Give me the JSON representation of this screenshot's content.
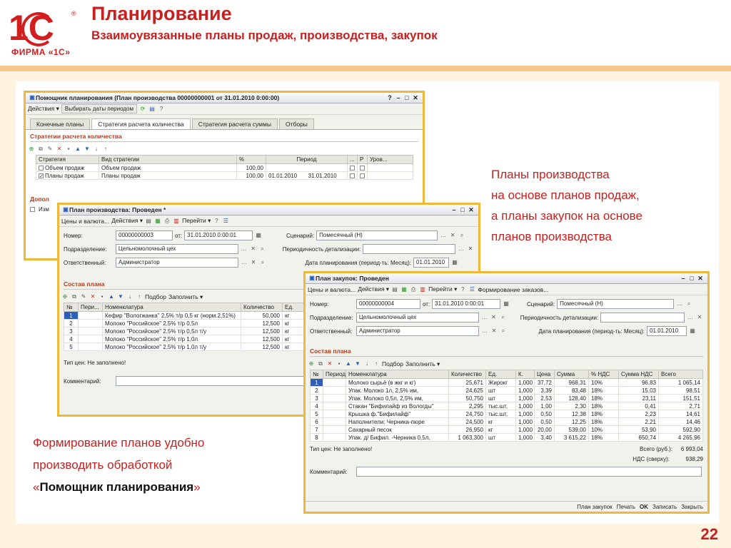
{
  "header": {
    "title": "Планирование",
    "subtitle": "Взаимоувязанные планы продаж, производства, закупок",
    "logo_caption": "ФИРМА «1С»"
  },
  "note_right": [
    "Планы производства",
    "на основе планов продаж,",
    "а планы закупок на основе",
    "планов производства"
  ],
  "note_left": {
    "l1": "Формирование планов  удобно",
    "l2": "производить обработкой",
    "q_open": "«",
    "strong": "Помощник планирования",
    "q_close": "»"
  },
  "page_number": "22",
  "colors": {
    "accent": "#c8201e",
    "frame": "#f0b83a",
    "selection": "#2e5fb8"
  },
  "w1": {
    "title": "Помощник планирования (План производства 00000000001 от 31.01.2010 0:00:00)",
    "actions": "Действия ▾",
    "select_dates": "Выбирать даты периодом",
    "tabs": [
      "Конечные планы",
      "Стратегия расчета количества",
      "Стратегия расчета суммы",
      "Отборы"
    ],
    "section": "Стратегии расчета количества",
    "cols": [
      "Стратегия",
      "Вид стратегии",
      "%",
      "Период",
      "...",
      "Р",
      "Уров..."
    ],
    "rows": [
      {
        "name": "Объем продаж",
        "kind": "Объем продаж",
        "pct": "100,00",
        "from": "",
        "to": "",
        "checked": false
      },
      {
        "name": "Планы продаж",
        "kind": "Планы продаж",
        "pct": "100,00",
        "from": "01.01.2010",
        "to": "31.01.2010",
        "checked": true
      }
    ],
    "extra_section": "Допол",
    "extra_check": "Изм"
  },
  "w2": {
    "title": "План производства: Проведен *",
    "toolbar": [
      "Цены и валюта...",
      "Действия ▾",
      "Перейти ▾"
    ],
    "number_label": "Номер:",
    "number": "00000000003",
    "date_label": "от:",
    "date": "31.01.2010  0:00:01",
    "scenario_label": "Сценарий:",
    "scenario": "Помесячный (Н)",
    "division_label": "Подразделение:",
    "division": "Цельномолочный цех",
    "detail_label": "Периодичность детализации:",
    "detail": "",
    "resp_label": "Ответственный:",
    "resp": "Администратор",
    "plan_date_label": "Дата планирования (период-ть: Месяц):",
    "plan_date": "01.01.2010",
    "section": "Состав плана",
    "pick": "Подбор",
    "fill": "Заполнить ▾",
    "cols": [
      "№",
      "Пери...",
      "Номенклатура",
      "Количество",
      "Ед."
    ],
    "rows": [
      [
        "1",
        "",
        "Кефир \"Вологжанка\" 2,5% т/р 0,5 кг (норм.2,51%)",
        "50,000",
        "кг"
      ],
      [
        "2",
        "",
        "Молоко \"Российское\" 2,5% т/р 0,5л",
        "12,500",
        "кг"
      ],
      [
        "3",
        "",
        "Молоко \"Российское\" 2,5% т/р 0,5л т/у",
        "12,500",
        "кг"
      ],
      [
        "4",
        "",
        "Молоко \"Российское\" 2,5% т/р 1,0л",
        "12,500",
        "кг"
      ],
      [
        "5",
        "",
        "Молоко \"Российское\" 2,5% т/р 1,0л т/у",
        "12,500",
        "кг"
      ]
    ],
    "price_type": "Тип цен: Не заполнено!",
    "comment_label": "Комментарий:"
  },
  "w3": {
    "title": "План закупок: Проведен",
    "toolbar": [
      "Цены и валюта...",
      "Действия ▾",
      "Перейти ▾",
      "Формирование заказов..."
    ],
    "number_label": "Номер:",
    "number": "00000000004",
    "date_label": "от:",
    "date": "31.01.2010  0:00:01",
    "scenario_label": "Сценарий:",
    "scenario": "Помесячный (Н)",
    "division_label": "Подразделение:",
    "division": "Цельномолочный цех",
    "detail_label": "Периодичность детализации:",
    "detail": "",
    "resp_label": "Ответственный:",
    "resp": "Администратор",
    "plan_date_label": "Дата планирования (период-ть: Месяц):",
    "plan_date": "01.01.2010",
    "section": "Состав плана",
    "pick": "Подбор",
    "fill": "Заполнить ▾",
    "cols": [
      "№",
      "Период",
      "Номенклатура",
      "Количество",
      "Ед.",
      "К.",
      "Цена",
      "Сумма",
      "% НДС",
      "Сумма НДС",
      "Всего"
    ],
    "rows": [
      [
        "1",
        "",
        "Молоко сырьё (в жкг и кг)",
        "25,671",
        "Жирокг",
        "1,000",
        "37,72",
        "968,31",
        "10%",
        "96,83",
        "1 065,14"
      ],
      [
        "2",
        "",
        "Упак. Молоко 1л, 2,5% им,",
        "24,625",
        "шт",
        "1,000",
        "3,39",
        "83,48",
        "18%",
        "15,03",
        "98,51"
      ],
      [
        "3",
        "",
        "Упак. Молоко  0,5л, 2,5% им,",
        "50,750",
        "шт",
        "1,000",
        "2,53",
        "128,40",
        "18%",
        "23,11",
        "151,51"
      ],
      [
        "4",
        "",
        "Стакан  \"Бифилайф  из  Вологды\"",
        "2,295",
        "тыс.шт,",
        "1,000",
        "1,00",
        "2,30",
        "18%",
        "0,41",
        "2,71"
      ],
      [
        "5",
        "",
        "Крышка ф.\"Бифилайф\"",
        "24,750",
        "тыс.шт,",
        "1,000",
        "0,50",
        "12,38",
        "18%",
        "2,23",
        "14,61"
      ],
      [
        "6",
        "",
        "Наполнители: Черника-пюре",
        "24,500",
        "кг",
        "1,000",
        "0,50",
        "12,25",
        "18%",
        "2,21",
        "14,46"
      ],
      [
        "7",
        "",
        "Сахарный песок",
        "26,950",
        "кг",
        "1,000",
        "20,00",
        "539,00",
        "10%",
        "53,90",
        "592,90"
      ],
      [
        "8",
        "",
        "Упак. д/ Бифил. -Черника 0,5л,",
        "1 063,300",
        "шт",
        "1,000",
        "3,40",
        "3 615,22",
        "18%",
        "650,74",
        "4 265,96"
      ]
    ],
    "price_type": "Тип цен: Не заполнено!",
    "total_label": "Всего (руб.):",
    "total": "6 993,04",
    "vat_label": "НДС (сверху):",
    "vat": "938,29",
    "comment_label": "Комментарий:",
    "bottom": [
      "План закупок",
      "Печать",
      "OK",
      "Записать",
      "Закрыть"
    ]
  }
}
